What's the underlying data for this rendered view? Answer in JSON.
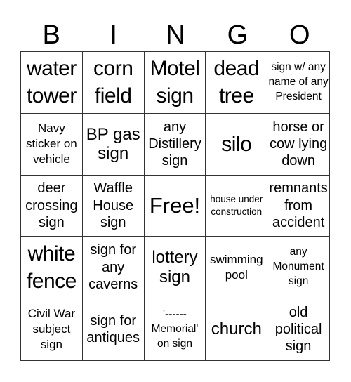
{
  "header": [
    "B",
    "I",
    "N",
    "G",
    "O"
  ],
  "cells": [
    {
      "text": "water tower",
      "size": "s-xl"
    },
    {
      "text": "corn field",
      "size": "s-xl"
    },
    {
      "text": "Motel sign",
      "size": "s-xl"
    },
    {
      "text": "dead tree",
      "size": "s-xl"
    },
    {
      "text": "sign w/ any name of any President",
      "size": "s-xs"
    },
    {
      "text": "Navy sticker on vehicle",
      "size": "s-s"
    },
    {
      "text": "BP gas sign",
      "size": "s-l"
    },
    {
      "text": "any Distillery sign",
      "size": "s-m"
    },
    {
      "text": "silo",
      "size": "s-xl"
    },
    {
      "text": "horse or cow lying down",
      "size": "s-m"
    },
    {
      "text": "deer crossing sign",
      "size": "s-m"
    },
    {
      "text": "Waffle House sign",
      "size": "s-m"
    },
    {
      "text": "Free!",
      "size": "s-free"
    },
    {
      "text": "house under construction",
      "size": "s-xxs"
    },
    {
      "text": "remnants from accident",
      "size": "s-m"
    },
    {
      "text": "white fence",
      "size": "s-xl"
    },
    {
      "text": "sign for any caverns",
      "size": "s-m"
    },
    {
      "text": "lottery sign",
      "size": "s-l"
    },
    {
      "text": "swimming pool",
      "size": "s-s"
    },
    {
      "text": "any Monument sign",
      "size": "s-xs"
    },
    {
      "text": "Civil War subject sign",
      "size": "s-s"
    },
    {
      "text": "sign for antiques",
      "size": "s-m"
    },
    {
      "text": "'------ Memorial' on sign",
      "size": "s-xs"
    },
    {
      "text": "church",
      "size": "s-l"
    },
    {
      "text": "old political sign",
      "size": "s-m"
    }
  ]
}
